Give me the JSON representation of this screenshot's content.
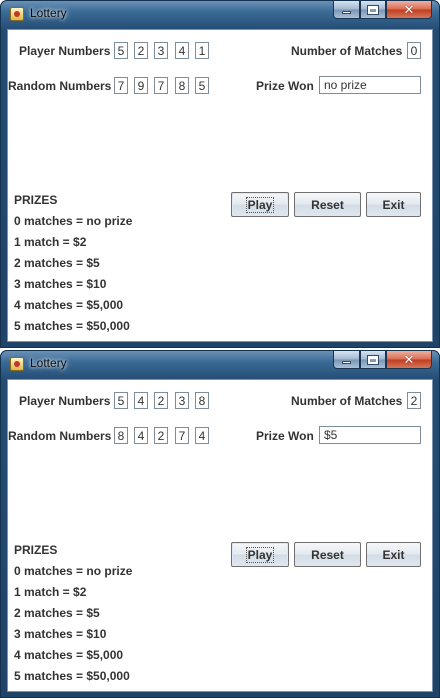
{
  "windows": [
    {
      "title": "Lottery",
      "player_label": "Player Numbers",
      "player_numbers": [
        "5",
        "2",
        "3",
        "4",
        "1"
      ],
      "random_label": "Random Numbers",
      "random_numbers": [
        "7",
        "9",
        "7",
        "8",
        "5"
      ],
      "matches_label": "Number of Matches",
      "matches_value": "0",
      "prize_label": "Prize Won",
      "prize_value": "no prize",
      "buttons": {
        "play": "Play",
        "reset": "Reset",
        "exit": "Exit"
      },
      "prizes_heading": "PRIZES",
      "prizes": [
        "0 matches = no prize",
        "1 match = $2",
        "2 matches = $5",
        "3 matches = $10",
        "4 matches = $5,000",
        "5 matches = $50,000"
      ]
    },
    {
      "title": "Lottery",
      "player_label": "Player Numbers",
      "player_numbers": [
        "5",
        "4",
        "2",
        "3",
        "8"
      ],
      "random_label": "Random Numbers",
      "random_numbers": [
        "8",
        "4",
        "2",
        "7",
        "4"
      ],
      "matches_label": "Number of Matches",
      "matches_value": "2",
      "prize_label": "Prize Won",
      "prize_value": "$5",
      "buttons": {
        "play": "Play",
        "reset": "Reset",
        "exit": "Exit"
      },
      "prizes_heading": "PRIZES",
      "prizes": [
        "0 matches = no prize",
        "1 match = $2",
        "2 matches = $5",
        "3 matches = $10",
        "4 matches = $5,000",
        "5 matches = $50,000"
      ]
    }
  ],
  "icons": {
    "app": "lottery-app-icon",
    "minimize": "minimize-icon",
    "maximize": "maximize-icon",
    "close": "close-icon"
  }
}
